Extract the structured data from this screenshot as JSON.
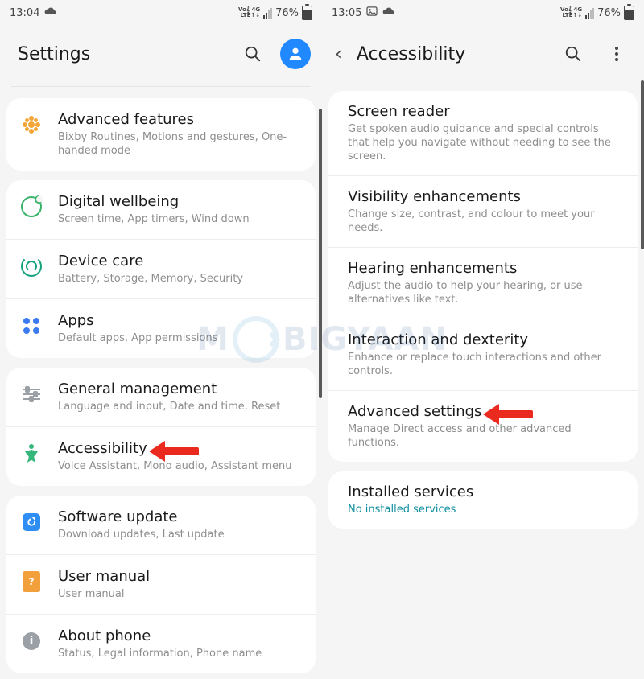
{
  "left": {
    "status": {
      "time": "13:04",
      "net_label": "Vo) 4G\nLTE↑↓",
      "battery_pct": "76%"
    },
    "header": {
      "title": "Settings"
    },
    "groups": [
      {
        "rows": [
          {
            "icon": "gear-flower-icon",
            "title": "Advanced features",
            "subtitle": "Bixby Routines, Motions and gestures, One-handed mode"
          }
        ]
      },
      {
        "rows": [
          {
            "icon": "wellbeing-icon",
            "title": "Digital wellbeing",
            "subtitle": "Screen time, App timers, Wind down"
          },
          {
            "icon": "device-care-icon",
            "title": "Device care",
            "subtitle": "Battery, Storage, Memory, Security"
          },
          {
            "icon": "apps-icon",
            "title": "Apps",
            "subtitle": "Default apps, App permissions"
          }
        ]
      },
      {
        "rows": [
          {
            "icon": "sliders-icon",
            "title": "General management",
            "subtitle": "Language and input, Date and time, Reset"
          },
          {
            "icon": "accessibility-icon",
            "title": "Accessibility",
            "subtitle": "Voice Assistant, Mono audio, Assistant menu",
            "arrow": true
          }
        ]
      },
      {
        "rows": [
          {
            "icon": "software-update-icon",
            "title": "Software update",
            "subtitle": "Download updates, Last update"
          },
          {
            "icon": "manual-icon",
            "title": "User manual",
            "subtitle": "User manual"
          },
          {
            "icon": "info-icon",
            "title": "About phone",
            "subtitle": "Status, Legal information, Phone name"
          }
        ]
      }
    ]
  },
  "right": {
    "status": {
      "time": "13:05",
      "net_label": "Vo) 4G\nLTE↑↓",
      "battery_pct": "76%"
    },
    "header": {
      "title": "Accessibility"
    },
    "groups": [
      {
        "rows": [
          {
            "title": "Screen reader",
            "subtitle": "Get spoken audio guidance and special controls that help you navigate without needing to see the screen."
          },
          {
            "title": "Visibility enhancements",
            "subtitle": "Change size, contrast, and colour to meet your needs."
          },
          {
            "title": "Hearing enhancements",
            "subtitle": "Adjust the audio to help your hearing, or use alternatives like text."
          },
          {
            "title": "Interaction and dexterity",
            "subtitle": "Enhance or replace touch interactions and other controls."
          },
          {
            "title": "Advanced settings",
            "subtitle": "Manage Direct access and other advanced functions.",
            "arrow": true
          }
        ]
      },
      {
        "rows": [
          {
            "title": "Installed services",
            "subtitle": "No installed services",
            "subtitle_link": true
          }
        ]
      }
    ]
  },
  "watermark": {
    "pre": "M",
    "post": "BIGYAAN"
  }
}
